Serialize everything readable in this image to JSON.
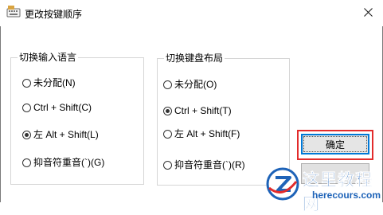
{
  "window": {
    "title": "更改按键顺序",
    "icon": "keyboard-settings-icon",
    "close_icon": "close-icon"
  },
  "input_language_group": {
    "label": "切换输入语言",
    "options": [
      {
        "label": "未分配(N)",
        "checked": false
      },
      {
        "label": "Ctrl + Shift(C)",
        "checked": false
      },
      {
        "label": "左 Alt + Shift(L)",
        "checked": true
      },
      {
        "label": "抑音符重音(`)(G)",
        "checked": false
      }
    ]
  },
  "keyboard_layout_group": {
    "label": "切换键盘布局",
    "options": [
      {
        "label": "未分配(O)",
        "checked": false
      },
      {
        "label": "Ctrl + Shift(T)",
        "checked": true
      },
      {
        "label": "左 Alt + Shift(F)",
        "checked": false
      },
      {
        "label": "抑音符重音(`)(R)",
        "checked": false
      }
    ]
  },
  "buttons": {
    "ok_label": "确定"
  },
  "highlight_color": "#e22b2b",
  "accent_color": "#0078d7",
  "watermark": {
    "name": "这里教程网",
    "url": "herecours.com",
    "color": "#1e63b8"
  }
}
